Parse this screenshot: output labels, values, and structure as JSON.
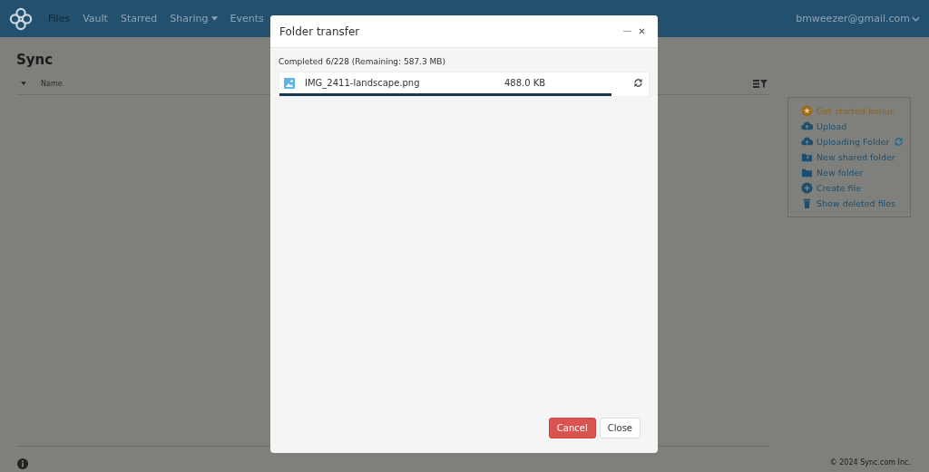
{
  "nav": {
    "items": [
      {
        "label": "Files",
        "selected": true,
        "dropdown": false
      },
      {
        "label": "Vault",
        "selected": false,
        "dropdown": false
      },
      {
        "label": "Starred",
        "selected": false,
        "dropdown": false
      },
      {
        "label": "Sharing",
        "selected": false,
        "dropdown": true
      },
      {
        "label": "Events",
        "selected": false,
        "dropdown": false
      }
    ],
    "account": "bmweezer@gmail.com"
  },
  "page": {
    "title": "Sync",
    "columns": [
      "Name"
    ]
  },
  "actions": [
    {
      "label": "Get started bonus",
      "kind": "bonus"
    },
    {
      "label": "Upload",
      "kind": "upload"
    },
    {
      "label": "Uploading Folder",
      "kind": "uploading"
    },
    {
      "label": "New shared folder",
      "kind": "shared"
    },
    {
      "label": "New folder",
      "kind": "folder"
    },
    {
      "label": "Create file",
      "kind": "create"
    },
    {
      "label": "Show deleted files",
      "kind": "trash"
    }
  ],
  "footer": {
    "copyright": "© 2024 Sync.com Inc."
  },
  "dialog": {
    "title": "Folder transfer",
    "status": "Completed 6/228 (Remaining: 587.3 MB)",
    "files": [
      {
        "name": "IMG_2411-landscape.png",
        "size": "488.0 KB",
        "level": 0.9
      }
    ],
    "buttons": [
      {
        "label": "Cancel",
        "kind": "danger"
      },
      {
        "label": "Close",
        "kind": "default"
      }
    ]
  }
}
